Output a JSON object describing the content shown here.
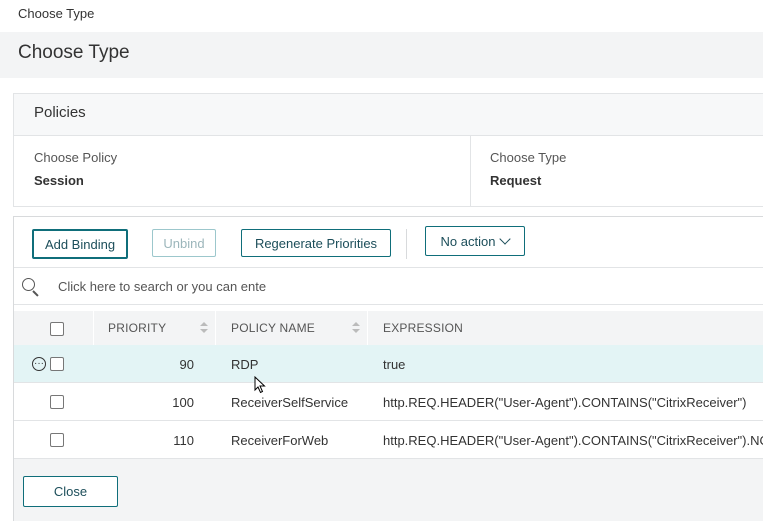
{
  "breadcrumb": "Choose Type",
  "page_title": "Choose Type",
  "policies": {
    "header": "Policies",
    "choose_policy_label": "Choose Policy",
    "choose_policy_value": "Session",
    "choose_type_label": "Choose Type",
    "choose_type_value": "Request"
  },
  "toolbar": {
    "add_binding": "Add Binding",
    "unbind": "Unbind",
    "regenerate": "Regenerate Priorities",
    "no_action": "No action"
  },
  "search": {
    "placeholder": "Click here to search or you can ente"
  },
  "table": {
    "headers": {
      "priority": "PRIORITY",
      "policy_name": "POLICY NAME",
      "expression": "EXPRESSION"
    },
    "rows": [
      {
        "priority": "90",
        "policy_name": "RDP",
        "expression": "true",
        "selected": true
      },
      {
        "priority": "100",
        "policy_name": "ReceiverSelfService",
        "expression": "http.REQ.HEADER(\"User-Agent\").CONTAINS(\"CitrixReceiver\")",
        "selected": false
      },
      {
        "priority": "110",
        "policy_name": "ReceiverForWeb",
        "expression": "http.REQ.HEADER(\"User-Agent\").CONTAINS(\"CitrixReceiver\").NOT",
        "selected": false
      }
    ]
  },
  "footer": {
    "close": "Close"
  },
  "colors": {
    "accent": "#0f6e7a",
    "selected_row": "#e3f4f5",
    "panel_bg": "#f3f4f5"
  }
}
